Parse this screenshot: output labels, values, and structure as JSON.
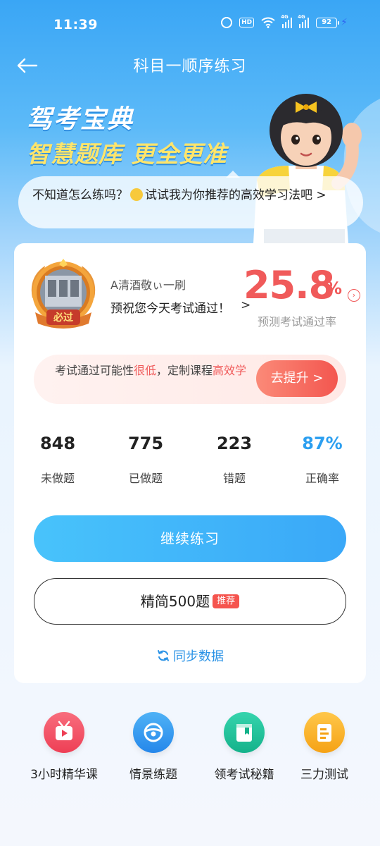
{
  "status_bar": {
    "time": "11:39",
    "battery": "92",
    "hd": "HD",
    "net1": "4G",
    "net2": "4G"
  },
  "nav": {
    "title": "科目一顺序练习",
    "back_icon": "arrow-left-icon"
  },
  "banner": {
    "line1": "驾考宝典",
    "line2": "智慧题库 更全更准",
    "tip": "不知道怎么练吗？",
    "tip_after_emoji": "试试我为你推荐的高效学习法吧 >"
  },
  "profile": {
    "medal_text": "必过",
    "username": "A清酒敬ぃ一刷",
    "wish": "预祝您今天考试通过！",
    "wish_arrow": ">",
    "pass_rate": "25.8",
    "pass_rate_unit": "%",
    "pass_rate_label": "预测考试通过率"
  },
  "tip_box": {
    "text_a": "考试通过可能性",
    "text_low": "很低",
    "text_b": "，定制课程",
    "text_high": "高效学",
    "button": "去提升 >"
  },
  "stats": [
    {
      "value": "848",
      "label": "未做题"
    },
    {
      "value": "775",
      "label": "已做题"
    },
    {
      "value": "223",
      "label": "错题"
    },
    {
      "value": "87%",
      "label": "正确率"
    }
  ],
  "buttons": {
    "continue": "继续练习",
    "simplified": "精简500题",
    "recommend_badge": "推荐",
    "sync": "同步数据"
  },
  "entries": [
    {
      "label": "3小时精华课",
      "icon": "video-play-icon",
      "color": "#f25567"
    },
    {
      "label": "情景练题",
      "icon": "steering-wheel-icon",
      "color": "#2f9bf0"
    },
    {
      "label": "领考试秘籍",
      "icon": "book-icon",
      "color": "#21c29a"
    },
    {
      "label": "三力测试",
      "icon": "test-paper-icon",
      "color": "#fbb22d"
    }
  ]
}
